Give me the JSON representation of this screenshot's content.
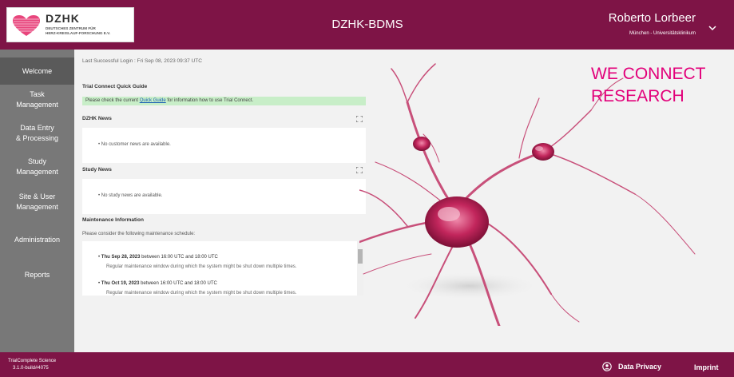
{
  "header": {
    "logo_text": "DZHK",
    "logo_sub_1": "DEUTSCHES ZENTRUM FÜR",
    "logo_sub_2": "HERZ-KREISLAUF-FORSCHUNG E.V.",
    "app_title": "DZHK-BDMS",
    "user_name": "Roberto Lorbeer",
    "user_org": "München - Universitätsklinikum",
    "brand_color": "#7e1446"
  },
  "sidebar": {
    "items": [
      {
        "label_1": "Welcome",
        "label_2": ""
      },
      {
        "label_1": "Task",
        "label_2": "Management"
      },
      {
        "label_1": "Data Entry",
        "label_2": "& Processing"
      },
      {
        "label_1": "Study",
        "label_2": "Management"
      },
      {
        "label_1": "Site & User",
        "label_2": "Management"
      },
      {
        "label_1": "Administration",
        "label_2": ""
      },
      {
        "label_1": "Reports",
        "label_2": ""
      }
    ]
  },
  "main": {
    "last_login": "Last Successful Login : Fri Sep 08, 2023 09:37 UTC",
    "quick_guide_title": "Trial Connect Quick Guide",
    "quick_guide_pre": "Please check the current ",
    "quick_guide_link": "Quick Guide",
    "quick_guide_post": " for information how to use Trial Connect.",
    "dzhk_news_title": "DZHK News",
    "dzhk_news_item": "No customer news are available.",
    "study_news_title": "Study News",
    "study_news_item": "No study news are available.",
    "maintenance_title": "Maintenance Information",
    "maintenance_intro": "Please consider the following maintenance schedule:",
    "maintenance_items": [
      {
        "date": "Thu Sep 28, 2023",
        "window": " between 16:00 UTC and 18:00 UTC",
        "note": "Regular maintenance window during which the system might be shut down multiple times."
      },
      {
        "date": "Thu Oct 19, 2023",
        "window": " between 16:00 UTC and 18:00 UTC",
        "note": "Regular maintenance window during which the system might be shut down multiple times."
      }
    ]
  },
  "hero": {
    "line_1": "WE CONNECT",
    "line_2": "RESEARCH",
    "accent_color": "#e2007a"
  },
  "footer": {
    "version_1": "TrialComplete Science",
    "version_2": "3.1.0-build#4075",
    "privacy": "Data Privacy",
    "imprint": "Imprint"
  }
}
